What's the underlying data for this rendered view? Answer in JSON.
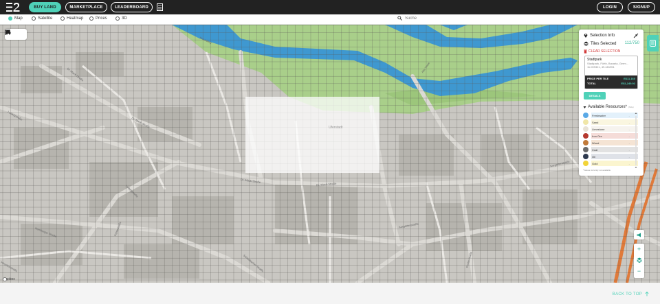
{
  "nav": {
    "buy_land": "BUY LAND",
    "marketplace": "MARKETPLACE",
    "leaderboard": "LEADERBOARD",
    "login": "LOGIN",
    "signup": "SIGNUP"
  },
  "views": {
    "map": "Map",
    "satellite": "Satellite",
    "heatmap": "Heatmap",
    "prices": "Prices",
    "three_d": "3D",
    "selected": "map"
  },
  "search": {
    "placeholder": "Suche"
  },
  "map": {
    "labels": {
      "kreuzberg": "Kreuzberg",
      "dr_mack_1": "Dr.-Mack-Straße",
      "dr_mack_2": "Dr.-Mack-Straße",
      "dr_mack_3": "Dr.-Mack-Straße",
      "dr_mack_4": "Dr.-Mack-Straße",
      "ludwigstrasse": "Ludwigstraße",
      "ludwig_2": "Ludwigstraße",
      "kurgartenstrasse": "Kurgartenstraße",
      "nuernberger": "Nürnberger Straße",
      "hirschenstrasse": "Hirschenstraße",
      "uferstadt": "Uferstadt",
      "kurgarten_2": "Kurgartenstraße",
      "fichtestrasse": "Fichtestraße",
      "schwabacher": "Schwabacher Straße",
      "gustavstrasse": "Gustavstraße",
      "alte_veste": "Alte Veste"
    },
    "attribution": "mapbox"
  },
  "selection": {
    "title": "Selection Info",
    "tiles_label": "Tiles Selected",
    "tiles_count": "112/750",
    "clear_label": "CLEAR SELECTION",
    "place_title": "Stadtpark",
    "place_sub": "Stadtpark, Fürth, Bavaria, Germ...",
    "place_coords": "11.009321, 49.481951",
    "price_label": "PRICE PER TILE",
    "price_value": "E$11.160",
    "total_label": "TOTAL",
    "total_value": "E$1,249.92",
    "details_label": "DETAILS",
    "resources_title": "Available Resources*",
    "resources_more": "(hide)",
    "resources": [
      {
        "name": "Freshwater",
        "value": "-",
        "color": "#5aa9e6",
        "bar": "#e3f1fb"
      },
      {
        "name": "Sand",
        "value": "-",
        "color": "#f0e6a8",
        "bar": "#faf6e0"
      },
      {
        "name": "Limestone",
        "value": "-",
        "color": "#e8e2d6",
        "bar": "#f6f3ee"
      },
      {
        "name": "Iron Ore",
        "value": "-",
        "color": "#b5392f",
        "bar": "#f5dcd8"
      },
      {
        "name": "Wood",
        "value": "-",
        "color": "#c17a3a",
        "bar": "#f5e4d4"
      },
      {
        "name": "Coal",
        "value": "-",
        "color": "#6b6b6b",
        "bar": "#e2e2e2"
      },
      {
        "name": "Oil",
        "value": "-",
        "color": "#2e3a4f",
        "bar": "#dfe2e8"
      },
      {
        "name": "Gold",
        "value": "-",
        "color": "#f2d43a",
        "bar": "#fbf5cf"
      }
    ],
    "note": "*Values currently not available"
  },
  "footer": {
    "back_to_top": "BACK TO TOP"
  },
  "colors": {
    "accent": "#4fd1b8",
    "danger": "#d23a3a",
    "topbar": "#222222"
  }
}
